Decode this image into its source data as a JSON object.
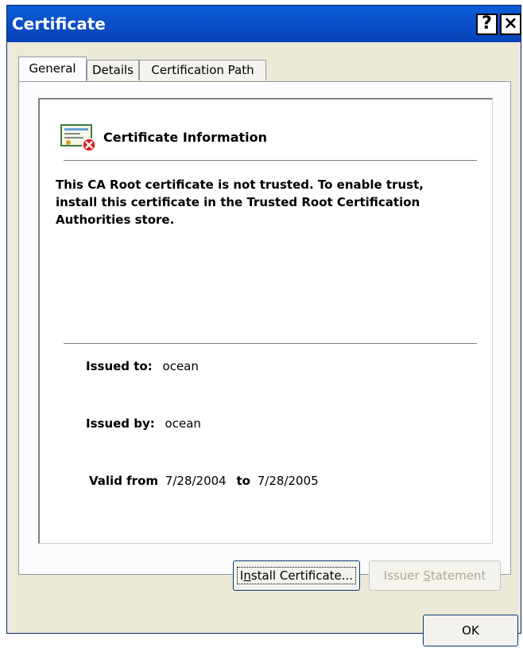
{
  "window": {
    "title": "Certificate",
    "help_glyph": "?",
    "close_glyph": "×"
  },
  "tabs": [
    {
      "label": "General",
      "active": true
    },
    {
      "label": "Details",
      "active": false
    },
    {
      "label": "Certification Path",
      "active": false
    }
  ],
  "general": {
    "icon": "certificate-error-icon",
    "heading": "Certificate Information",
    "message": "This CA Root certificate is not trusted. To enable trust, install this certificate in the Trusted Root Certification Authorities store.",
    "issued_to_label": "Issued to:",
    "issued_to_value": "ocean",
    "issued_by_label": "Issued by:",
    "issued_by_value": "ocean",
    "valid_from_label": "Valid from",
    "valid_from_value": "7/28/2004",
    "valid_to_label": "to",
    "valid_to_value": "7/28/2005"
  },
  "buttons": {
    "install_pre": "I",
    "install_accel": "n",
    "install_post": "stall Certificate...",
    "issuer_pre": "Issuer ",
    "issuer_accel": "S",
    "issuer_post": "tatement",
    "ok": "OK"
  },
  "colors": {
    "title_bar": "#0b4fc8",
    "dialog_bg": "#ece9d8",
    "error_red": "#e02020"
  }
}
